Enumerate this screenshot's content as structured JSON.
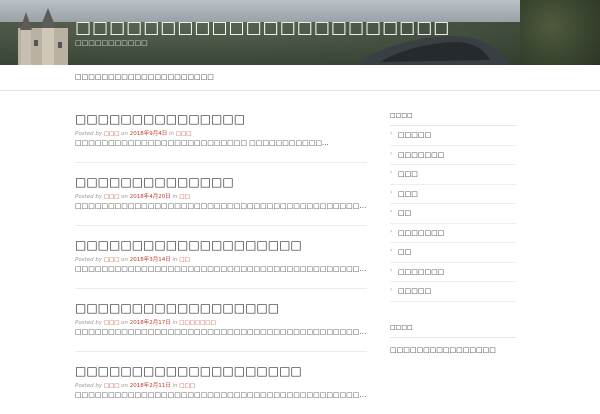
{
  "header": {
    "site_title": "□□□□□□□□□□□□□□□□□□□□□□",
    "site_description": "□□□□□□□□□□□"
  },
  "nav": {
    "menu_label": "□□□□□□□□□□□□□□□□□□□□□"
  },
  "posts": [
    {
      "title": "□□□□□□□□□□□□□□□",
      "posted_by": "Posted by",
      "author": "□□□",
      "on": "on",
      "date": "2018年9月4日",
      "in": "in",
      "category": "□□□",
      "excerpt": "□□□□□□□□□□□□□□□□□□□□□□□□□□ □□□□□□□□□□□…"
    },
    {
      "title": "□□□□□□□□□□□□□□",
      "posted_by": "Posted by",
      "author": "□□□",
      "on": "on",
      "date": "2018年4月20日",
      "in": "in",
      "category": "□□",
      "excerpt": "□□□□□□□□□□□□□□□□□□□□□□□□□□□□□□□□□□□□□□□□□□□…"
    },
    {
      "title": "□□□□□□□□□□□□□□□□□□□□",
      "posted_by": "Posted by",
      "author": "□□□",
      "on": "on",
      "date": "2018年3月14日",
      "in": "in",
      "category": "□□",
      "excerpt": "□□□□□□□□□□□□□□□□□□□□□□□□□□□□□□□□□□□□□□□□□□□…"
    },
    {
      "title": "□□□□□□□□□□□□□□□□□□",
      "posted_by": "Posted by",
      "author": "□□□",
      "on": "on",
      "date": "2018年2月17日",
      "in": "in",
      "category": "□□□□□□□",
      "excerpt": "□□□□□□□□□□□□□□□□□□□□□□□□□□□□□□□□□□□□□□□□□□□…"
    },
    {
      "title": "□□□□□□□□□□□□□□□□□□□□",
      "posted_by": "Posted by",
      "author": "□□□",
      "on": "on",
      "date": "2018年2月11日",
      "in": "in",
      "category": "□□□",
      "excerpt": "□□□□□□□□□□□□□□□□□□□□□□□□□□□□□□□□□□□□□□□□□□□…"
    }
  ],
  "sidebar": {
    "categories_title": "□□□□",
    "categories": [
      {
        "label": "□□□□□"
      },
      {
        "label": "□□□□□□□"
      },
      {
        "label": "□□□"
      },
      {
        "label": "□□□"
      },
      {
        "label": "□□"
      },
      {
        "label": "□□□□□□□"
      },
      {
        "label": "□□"
      },
      {
        "label": "□□□□□□□"
      },
      {
        "label": "□□□□□"
      }
    ],
    "widget2_title": "□□□□",
    "widget2_item": "□□□□□□□□□□□□□□□□"
  }
}
